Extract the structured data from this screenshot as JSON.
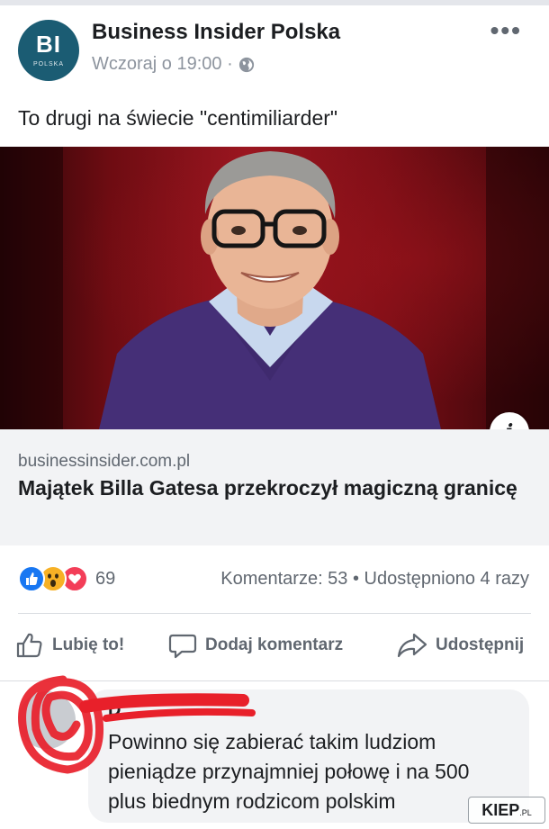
{
  "post": {
    "page_name": "Business Insider Polska",
    "timestamp": "Wczoraj o 19:00 ·",
    "avatar_text": "BI",
    "avatar_subtext": "POLSKA",
    "more_label": "•••",
    "text": "To drugi na świecie \"centimiliarder\""
  },
  "link": {
    "domain": "businessinsider.com.pl",
    "title": "Majątek Billa Gatesa przekroczył magiczną granicę",
    "info_icon": "i"
  },
  "stats": {
    "reaction_count": "69",
    "comments_shares": "Komentarze: 53 • Udostępniono 4 razy"
  },
  "actions": {
    "like": "Lubię to!",
    "comment": "Dodaj komentarz",
    "share": "Udostępnij"
  },
  "comment": {
    "author": "D",
    "text": "Powinno się zabierać takim ludziom pieniądze przynajmniej połowę i na 500 plus biednym rodzicom polskim"
  },
  "watermark": {
    "main": "KIEP",
    "suffix": ".PL"
  },
  "colors": {
    "avatar_bg": "#1b5c73",
    "like_blue": "#1877f2",
    "love_red": "#f33e58",
    "wow_yellow": "#f7b125",
    "scribble_red": "#e8202a"
  },
  "icons": [
    "globe-icon",
    "like-thumb-icon",
    "comment-icon",
    "share-icon",
    "info-icon"
  ]
}
